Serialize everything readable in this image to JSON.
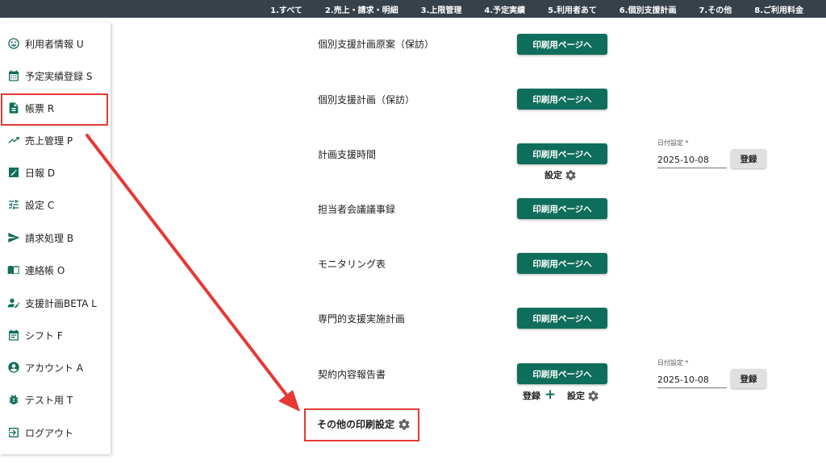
{
  "topnav": [
    "1.すべて",
    "2.売上・請求・明細",
    "3.上限管理",
    "4.予定実績",
    "5.利用者あて",
    "6.個別支援計画",
    "7.その他",
    "8.ご利用料金"
  ],
  "sidebar": {
    "items": [
      {
        "label": "利用者情報 U",
        "icon": "smiley-icon"
      },
      {
        "label": "予定実績登録 S",
        "icon": "calendar-icon"
      },
      {
        "label": "帳票 R",
        "icon": "document-icon"
      },
      {
        "label": "売上管理 P",
        "icon": "trending-up-icon"
      },
      {
        "label": "日報 D",
        "icon": "edit-icon"
      },
      {
        "label": "設定 C",
        "icon": "tune-icon"
      },
      {
        "label": "請求処理 B",
        "icon": "send-icon"
      },
      {
        "label": "連絡帳 O",
        "icon": "book-icon"
      },
      {
        "label": "支援計画BETA L",
        "icon": "person-edit-icon"
      },
      {
        "label": "シフト F",
        "icon": "calendar-list-icon"
      },
      {
        "label": "アカウント A",
        "icon": "account-circle-icon"
      },
      {
        "label": "テスト用 T",
        "icon": "bug-icon"
      },
      {
        "label": "ログアウト",
        "icon": "logout-icon"
      }
    ],
    "highlighted_index": 2
  },
  "main": {
    "rows": [
      {
        "label": "個別支援計画原案（保訪）",
        "button": "印刷用ページへ"
      },
      {
        "label": "個別支援計画（保訪）",
        "button": "印刷用ページへ"
      },
      {
        "label": "計画支援時間",
        "button": "印刷用ページへ",
        "setting": "設定"
      },
      {
        "label": "担当者会議議事録",
        "button": "印刷用ページへ"
      },
      {
        "label": "モニタリング表",
        "button": "印刷用ページへ"
      },
      {
        "label": "専門的支援実施計画",
        "button": "印刷用ページへ"
      },
      {
        "label": "契約内容報告書",
        "button": "印刷用ページへ",
        "add": "登録",
        "setting": "設定"
      }
    ],
    "date_fields": [
      {
        "label": "日付設定 *",
        "value": "2025-10-08",
        "button": "登録"
      },
      {
        "label": "日付設定 *",
        "value": "2025-10-08",
        "button": "登録"
      }
    ],
    "other_print_settings": "その他の印刷設定"
  },
  "colors": {
    "topbar": "#37414a",
    "accent": "#0f6e5b",
    "highlight": "#e53935"
  }
}
